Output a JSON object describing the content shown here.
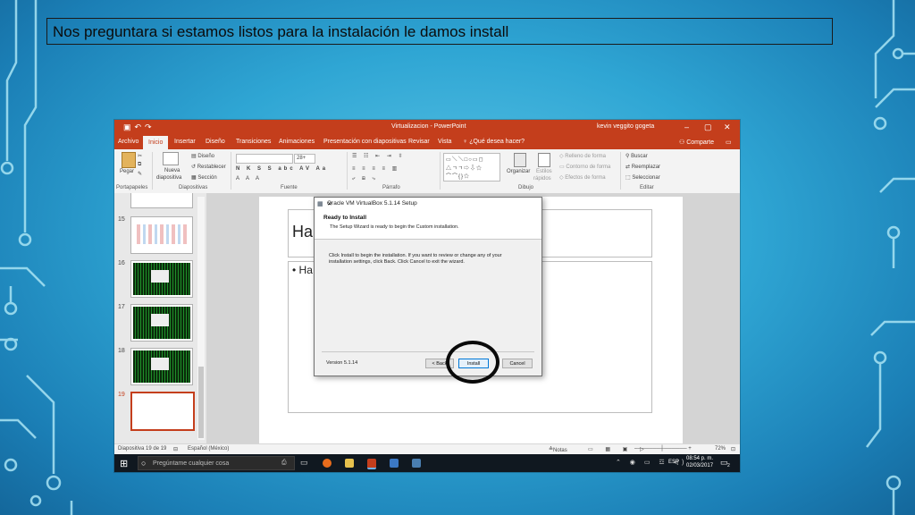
{
  "slide_caption": "Nos preguntara si estamos listos para la instalación le damos install",
  "powerpoint": {
    "window_title": "Virtualizacion - PowerPoint",
    "user_name": "kevin veggito gogeta",
    "tabs": [
      "Archivo",
      "Inicio",
      "Insertar",
      "Diseño",
      "Transiciones",
      "Animaciones",
      "Presentación con diapositivas",
      "Revisar",
      "Vista",
      "¿Qué desea hacer?"
    ],
    "share_label": "Comparte",
    "ribbon": {
      "paste": "Pegar",
      "new_slide": "Nueva",
      "new_slide_2": "diapositiva",
      "layout": "Diseño",
      "reset": "Restablecer",
      "section": "Sección",
      "font_size": "28+",
      "arrange": "Organizar",
      "quick_styles": "Estilos",
      "quick_styles_2": "rápidos",
      "shape_fill": "Relleno de forma",
      "shape_outline": "Contorno de forma",
      "shape_effects": "Efectos de forma",
      "find": "Buscar",
      "replace": "Reemplazar",
      "select": "Seleccionar",
      "groups": [
        "Portapapeles",
        "Diapositivas",
        "Fuente",
        "Párrafo",
        "Dibujo",
        "Editar"
      ]
    },
    "thumbnails": [
      "15",
      "16",
      "17",
      "18",
      "19"
    ],
    "slide_title_fragment": "Ha",
    "slide_bullet_fragment": "• Ha",
    "status": {
      "slide_counter": "Diapositiva 19 de 19",
      "language": "Español (México)",
      "notes": "Notas",
      "zoom": "72%"
    }
  },
  "dialog": {
    "title": "Oracle VM VirtualBox 5.1.14 Setup",
    "heading": "Ready to Install",
    "subheading": "The Setup Wizard is ready to begin the Custom installation.",
    "body_line1": "Click Install to begin the installation. If you want to review or change any of your",
    "body_line2": "installation settings, click Back. Click Cancel to exit the wizard.",
    "version": "Version 5.1.14",
    "back_button": "< Back",
    "install_button": "Install",
    "cancel_button": "Cancel"
  },
  "taskbar": {
    "search_placeholder": "Pregúntame cualquier cosa",
    "language": "ESP",
    "time": "08:54 p. m.",
    "date": "02/03/2017",
    "notification_count": "2"
  },
  "colors": {
    "powerpoint_accent": "#c43e1c",
    "background": "#2fa6d4",
    "circuit_lines": "#a9e4f4"
  }
}
